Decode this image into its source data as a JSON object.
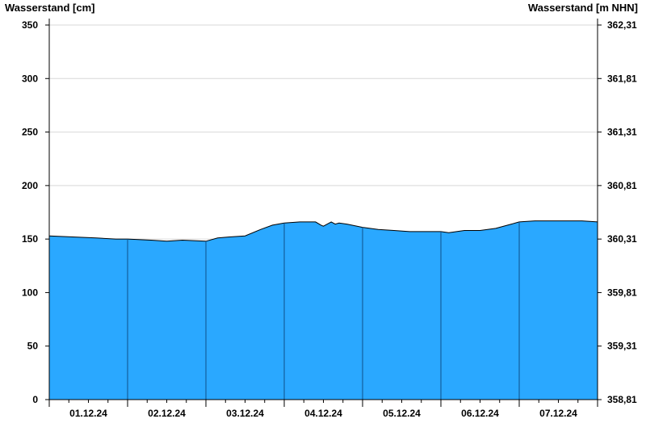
{
  "chart_data": {
    "type": "area",
    "ylabel_left": "Wasserstand [cm]",
    "ylabel_right": "Wasserstand [m NHN]",
    "ylim_left": [
      0,
      350
    ],
    "yticks_left": [
      0,
      50,
      100,
      150,
      200,
      250,
      300,
      350
    ],
    "ytick_labels_right": [
      "358,81",
      "359,31",
      "359,81",
      "360,31",
      "360,81",
      "361,31",
      "361,81",
      "362,31"
    ],
    "xlim_days": [
      0,
      7
    ],
    "x_tick_labels": [
      "01.12.24",
      "02.12.24",
      "03.12.24",
      "04.12.24",
      "05.12.24",
      "06.12.24",
      "07.12.24"
    ],
    "grid": true,
    "fill_color": "#2aa8ff",
    "series": [
      {
        "x": [
          0.0,
          0.3,
          0.6,
          0.85,
          1.0,
          1.3,
          1.5,
          1.7,
          2.0,
          2.15,
          2.3,
          2.5,
          2.7,
          2.85,
          3.0,
          3.2,
          3.4,
          3.47,
          3.5,
          3.55,
          3.6,
          3.65,
          3.7,
          3.8,
          4.0,
          4.2,
          4.4,
          4.6,
          4.8,
          5.0,
          5.1,
          5.3,
          5.5,
          5.7,
          5.9,
          6.0,
          6.2,
          6.4,
          6.6,
          6.8,
          7.0
        ],
        "y": [
          153,
          152,
          151,
          150,
          150,
          149,
          148,
          149,
          148,
          151,
          152,
          153,
          159,
          163,
          165,
          166,
          166,
          163,
          162,
          164,
          166,
          164,
          165,
          164,
          161,
          159,
          158,
          157,
          157,
          157,
          156,
          158,
          158,
          160,
          164,
          166,
          167,
          167,
          167,
          167,
          166
        ]
      }
    ]
  }
}
